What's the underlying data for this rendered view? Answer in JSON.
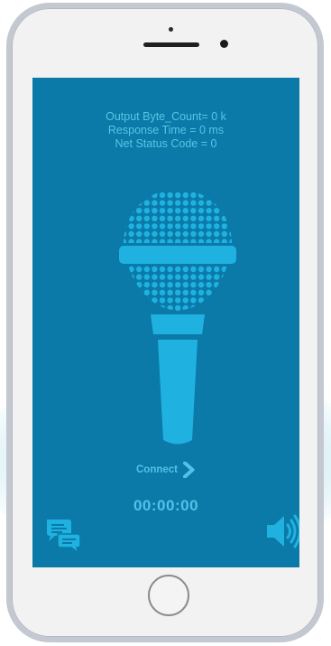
{
  "stats": {
    "output_byte_count": "Output Byte_Count= 0 k",
    "response_time": "Response Time = 0 ms",
    "net_status_code": "Net Status Code = 0"
  },
  "connect": {
    "label": "Connect",
    "icon": "chevron-right-icon"
  },
  "timer": "00:00:00",
  "icons": {
    "center": "microphone-icon",
    "bottom_left": "chat-bubbles-icon",
    "bottom_right": "speaker-volume-icon"
  },
  "colors": {
    "screen_background": "#0b7aa8",
    "accent": "#4fc3e8",
    "microphone": "#1fb2e0"
  }
}
